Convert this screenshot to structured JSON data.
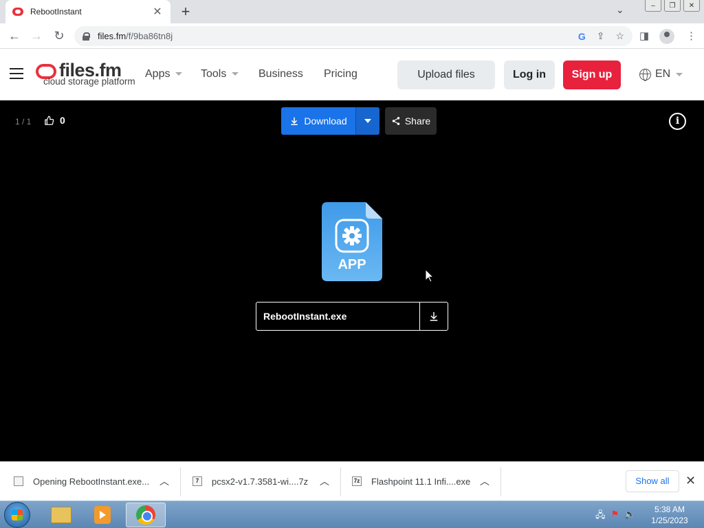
{
  "browser": {
    "tab_title": "RebootInstant",
    "url_host": "files.fm",
    "url_path": "/f/9ba86tn8j",
    "tab_close": "✕",
    "new_tab": "+"
  },
  "site": {
    "logo_name": "files.fm",
    "logo_tagline": "cloud storage platform",
    "nav": [
      "Apps",
      "Tools",
      "Business",
      "Pricing"
    ],
    "upload_label": "Upload files",
    "login_label": "Log in",
    "signup_label": "Sign up",
    "lang": "EN",
    "brand_color": "#e8213d"
  },
  "viewer": {
    "counter": "1 / 1",
    "likes": "0",
    "download_label": "Download",
    "share_label": "Share",
    "info_label": "i",
    "file_type": "APP",
    "file_name": "RebootInstant.exe"
  },
  "downloads": [
    {
      "label": "Opening RebootInstant.exe...",
      "icon": "exe-icon"
    },
    {
      "label": "pcsx2-v1.7.3581-wi....7z",
      "icon": "7z-icon"
    },
    {
      "label": "Flashpoint 11.1 Infi....exe",
      "icon": "7z-icon"
    }
  ],
  "downloads_show_all": "Show all",
  "taskbar": {
    "time": "5:38 AM",
    "date": "1/25/2023"
  }
}
